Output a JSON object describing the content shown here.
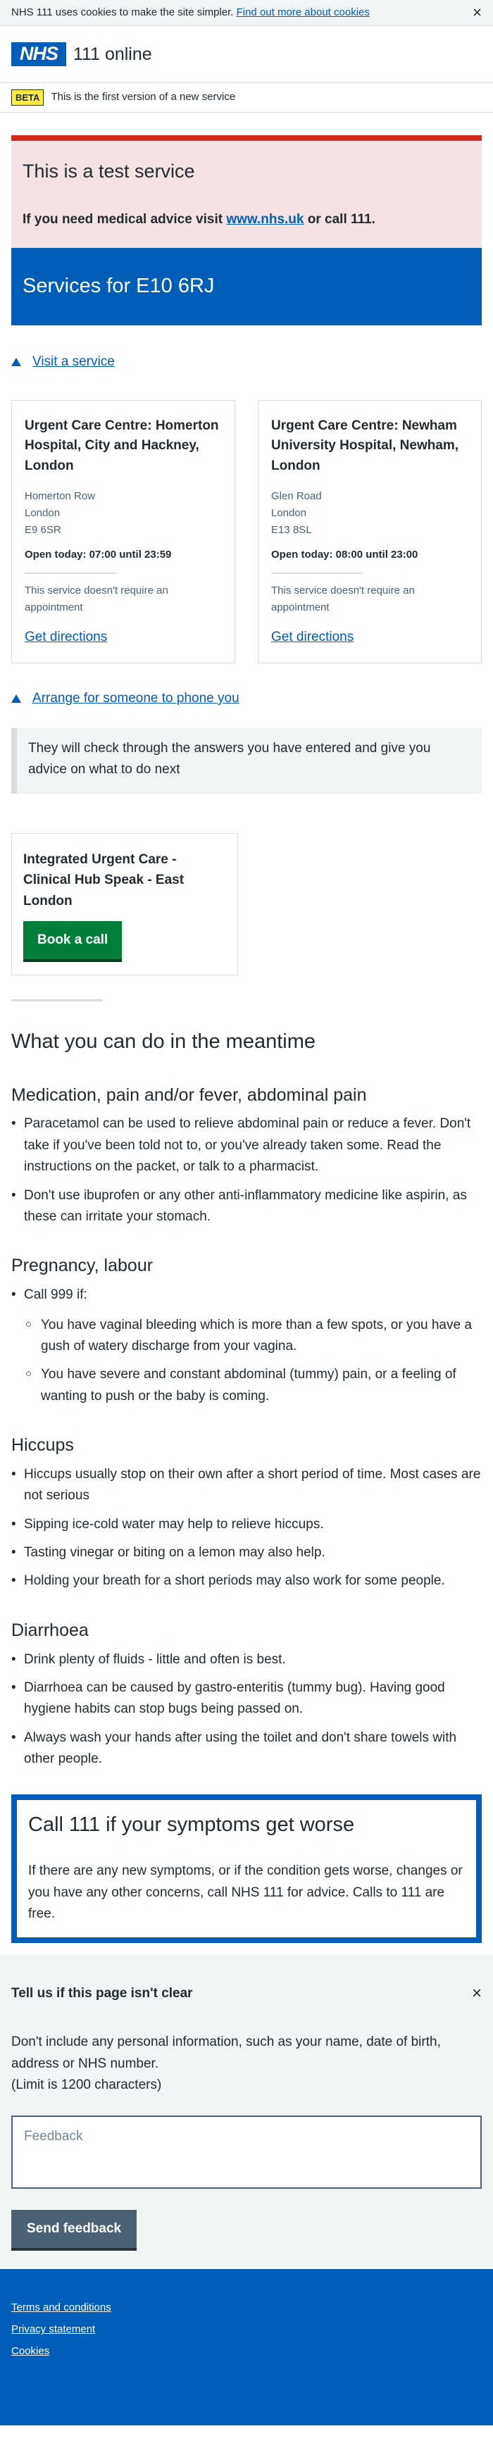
{
  "cookie_bar": {
    "text": "NHS 111 uses cookies to make the site simpler.",
    "link": "Find out more about cookies",
    "close": "×"
  },
  "header": {
    "logo": "NHS",
    "service_name": "111 online"
  },
  "beta": {
    "tag": "BETA",
    "text": "This is the first version of a new service"
  },
  "test_service": {
    "title": "This is a test service",
    "text_before": "If you need medical advice visit",
    "link": "www.nhs.uk",
    "text_after": "or call 111."
  },
  "banner": {
    "title": "Services for E10 6RJ"
  },
  "visit": {
    "link": "Visit a service",
    "cards": [
      {
        "name": "Urgent Care Centre: Homerton Hospital, City and Hackney, London",
        "address": [
          "Homerton Row",
          "London",
          "E9 6SR"
        ],
        "open": "Open today: 07:00 until 23:59",
        "note": "This service doesn't require an appointment",
        "directions": "Get directions"
      },
      {
        "name": "Urgent Care Centre: Newham University Hospital, Newham, London",
        "address": [
          "Glen Road",
          "London",
          "E13 8SL"
        ],
        "open": "Open today: 08:00 until 23:00",
        "note": "This service doesn't require an appointment",
        "directions": "Get directions"
      }
    ]
  },
  "phone": {
    "link": "Arrange for someone to phone you",
    "inset": "They will check through the answers you have entered and give you advice on what to do next",
    "card_title": "Integrated Urgent Care - Clinical Hub Speak - East London",
    "button": "Book a call"
  },
  "meantime": {
    "title": "What you can do in the meantime",
    "med_title": "Medication, pain and/or fever, abdominal pain",
    "med_items": [
      "Paracetamol can be used to relieve abdominal pain or reduce a fever. Don't take if you've been told not to, or you've already taken some. Read the instructions on the packet, or talk to a pharmacist.",
      "Don't use ibuprofen or any other anti-inflammatory medicine like aspirin, as these can irritate your stomach."
    ],
    "preg_title": "Pregnancy, labour",
    "preg_item": "Call 999 if:",
    "preg_sub": [
      "You have vaginal bleeding which is more than a few spots, or you have a gush of watery discharge from your vagina.",
      "You have severe and constant abdominal (tummy) pain, or a feeling of wanting to push or the baby is coming."
    ],
    "hic_title": "Hiccups",
    "hic_items": [
      "Hiccups usually stop on their own after a short period of time. Most cases are not serious",
      "Sipping ice-cold water may help to relieve hiccups.",
      "Tasting vinegar or biting on a lemon may also help.",
      "Holding your breath for a short periods may also work for some people."
    ],
    "dia_title": "Diarrhoea",
    "dia_items": [
      "Drink plenty of fluids - little and often is best.",
      "Diarrhoea can be caused by gastro-enteritis (tummy bug). Having good hygiene habits can stop bugs being passed on.",
      "Always wash your hands after using the toilet and don't share towels with other people."
    ]
  },
  "care_card": {
    "title": "Call 111 if your symptoms get worse",
    "text": "If there are any new symptoms, or if the condition gets worse, changes or you have any other concerns, call NHS 111 for advice. Calls to 111 are free."
  },
  "feedback": {
    "title": "Tell us if this page isn't clear",
    "close": "×",
    "text1": "Don't include any personal information, such as your name, date of birth, address or NHS number.",
    "text2": "(Limit is 1200 characters)",
    "placeholder": "Feedback",
    "button": "Send feedback"
  },
  "footer": {
    "links": [
      "Terms and conditions",
      "Privacy statement",
      "Cookies"
    ]
  },
  "colors": {
    "nhs_blue": "#005eb8",
    "green": "#007f3b",
    "red": "#d5281b",
    "grey_button": "#4c6272"
  }
}
